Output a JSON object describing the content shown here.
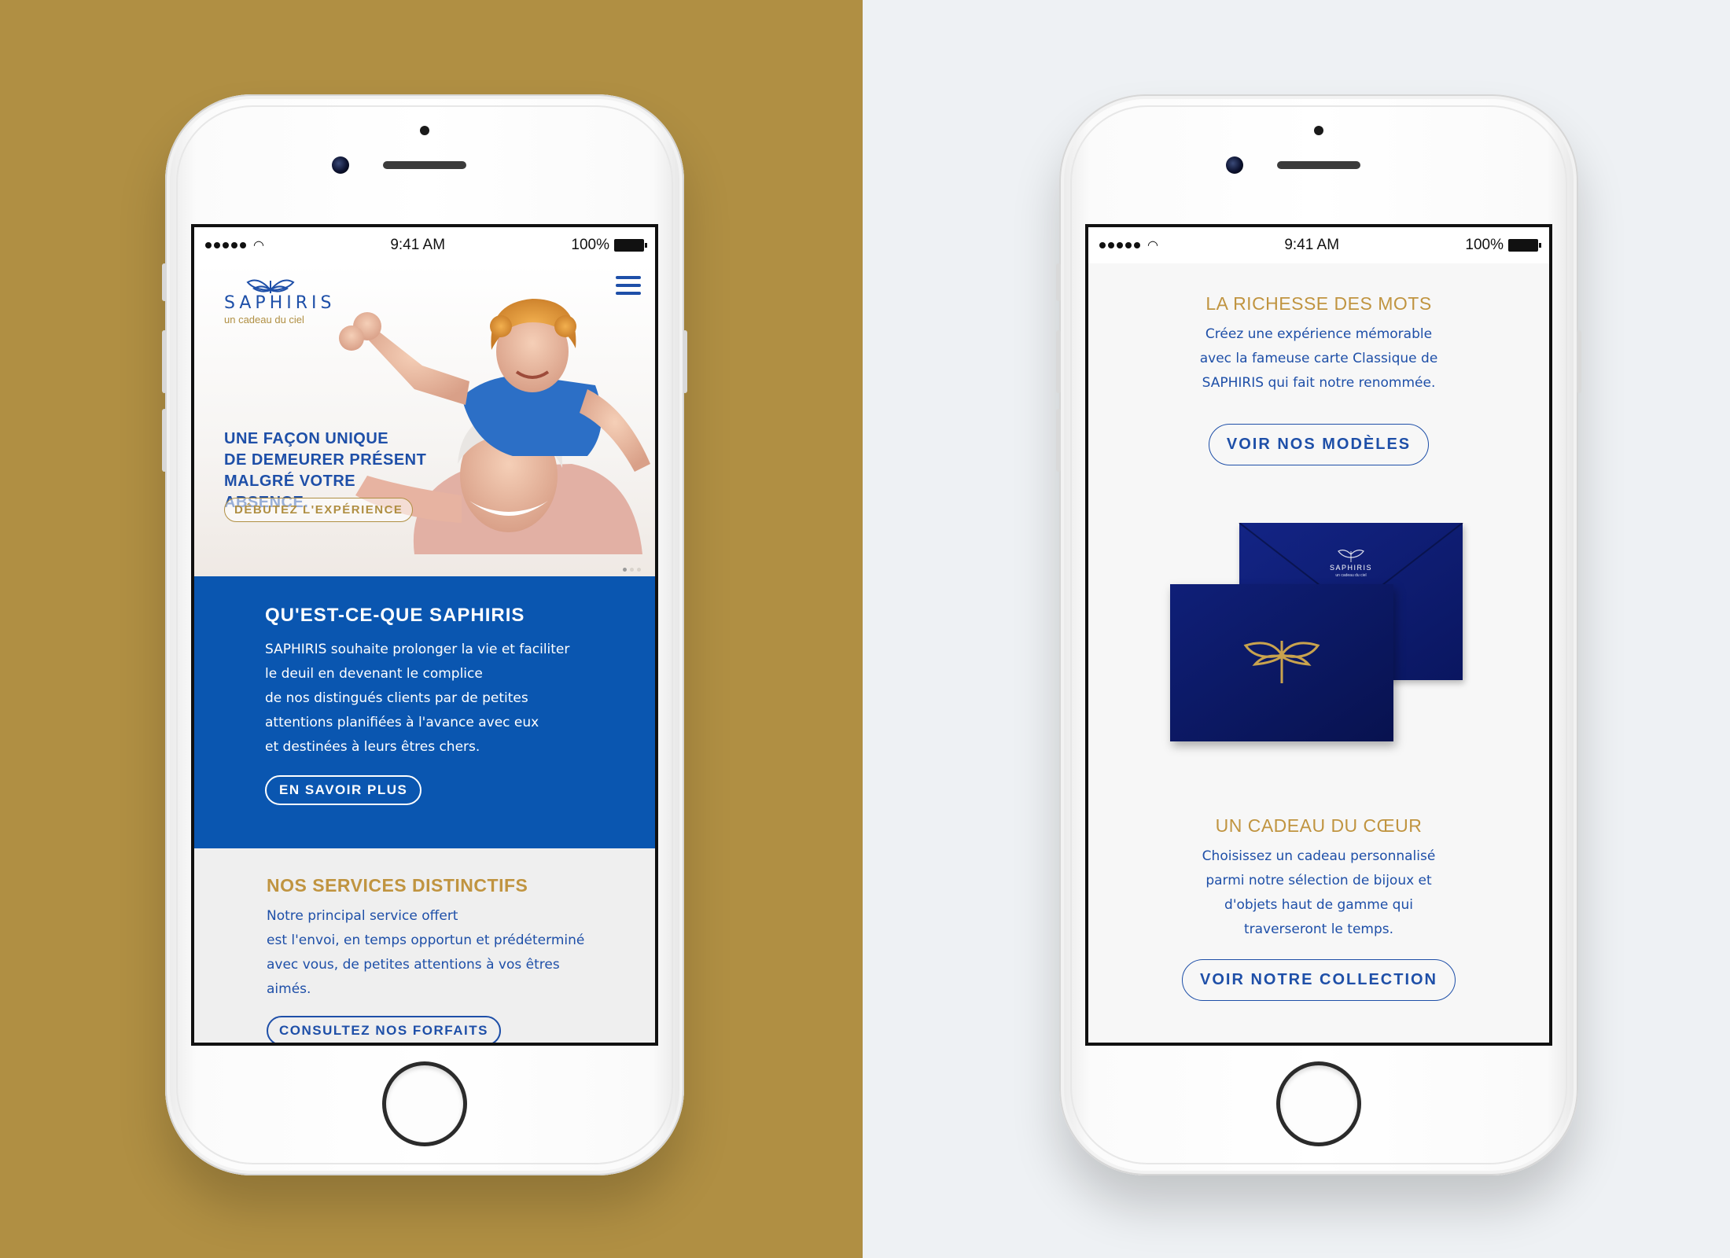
{
  "colors": {
    "background_left": "#b08f43",
    "background_right": "#eef1f4",
    "brand_blue": "#1e4fa8",
    "brand_gold": "#c09440",
    "section_blue": "#0a56b0",
    "envelope_navy": "#0d1a6b"
  },
  "status_bar": {
    "time": "9:41 AM",
    "battery": "100%"
  },
  "left_screen": {
    "logo": {
      "word": "SAPHIRIS",
      "tagline": "un cadeau du ciel"
    },
    "hero": {
      "headline_lines": [
        "UNE FAÇON UNIQUE",
        "DE DEMEURER PRÉSENT",
        "MALGRÉ VOTRE ABSENCE."
      ],
      "cta": "DÉBUTEZ L'EXPÉRIENCE"
    },
    "about": {
      "title": "QU'EST-CE-QUE SAPHIRIS",
      "lines": [
        "SAPHIRIS souhaite prolonger la vie et faciliter",
        "le deuil en devenant le complice",
        "de nos distingués clients par de petites",
        "attentions planifiées à l'avance avec eux",
        "et destinées à leurs êtres chers."
      ],
      "cta": "EN SAVOIR PLUS"
    },
    "services": {
      "title": "NOS SERVICES DISTINCTIFS",
      "lines": [
        "Notre principal service offert",
        "est l'envoi, en temps opportun et prédéterminé",
        "avec vous, de petites attentions à vos êtres",
        "aimés."
      ],
      "cta": "CONSULTEZ NOS FORFAITS"
    }
  },
  "right_screen": {
    "words": {
      "title": "LA RICHESSE DES MOTS",
      "lines": [
        "Créez une expérience mémorable",
        "avec la fameuse carte Classique de",
        "SAPHIRIS qui fait notre renommée."
      ],
      "cta": "VOIR NOS MODÈLES"
    },
    "envelope": {
      "logo_word": "SAPHIRIS",
      "logo_tagline": "un cadeau du ciel"
    },
    "gift": {
      "title": "UN CADEAU DU CŒUR",
      "lines": [
        "Choisissez un cadeau personnalisé",
        "parmi notre sélection de bijoux et",
        "d'objets haut de gamme qui",
        "traverseront le temps."
      ],
      "cta": "VOIR NOTRE COLLECTION"
    }
  }
}
